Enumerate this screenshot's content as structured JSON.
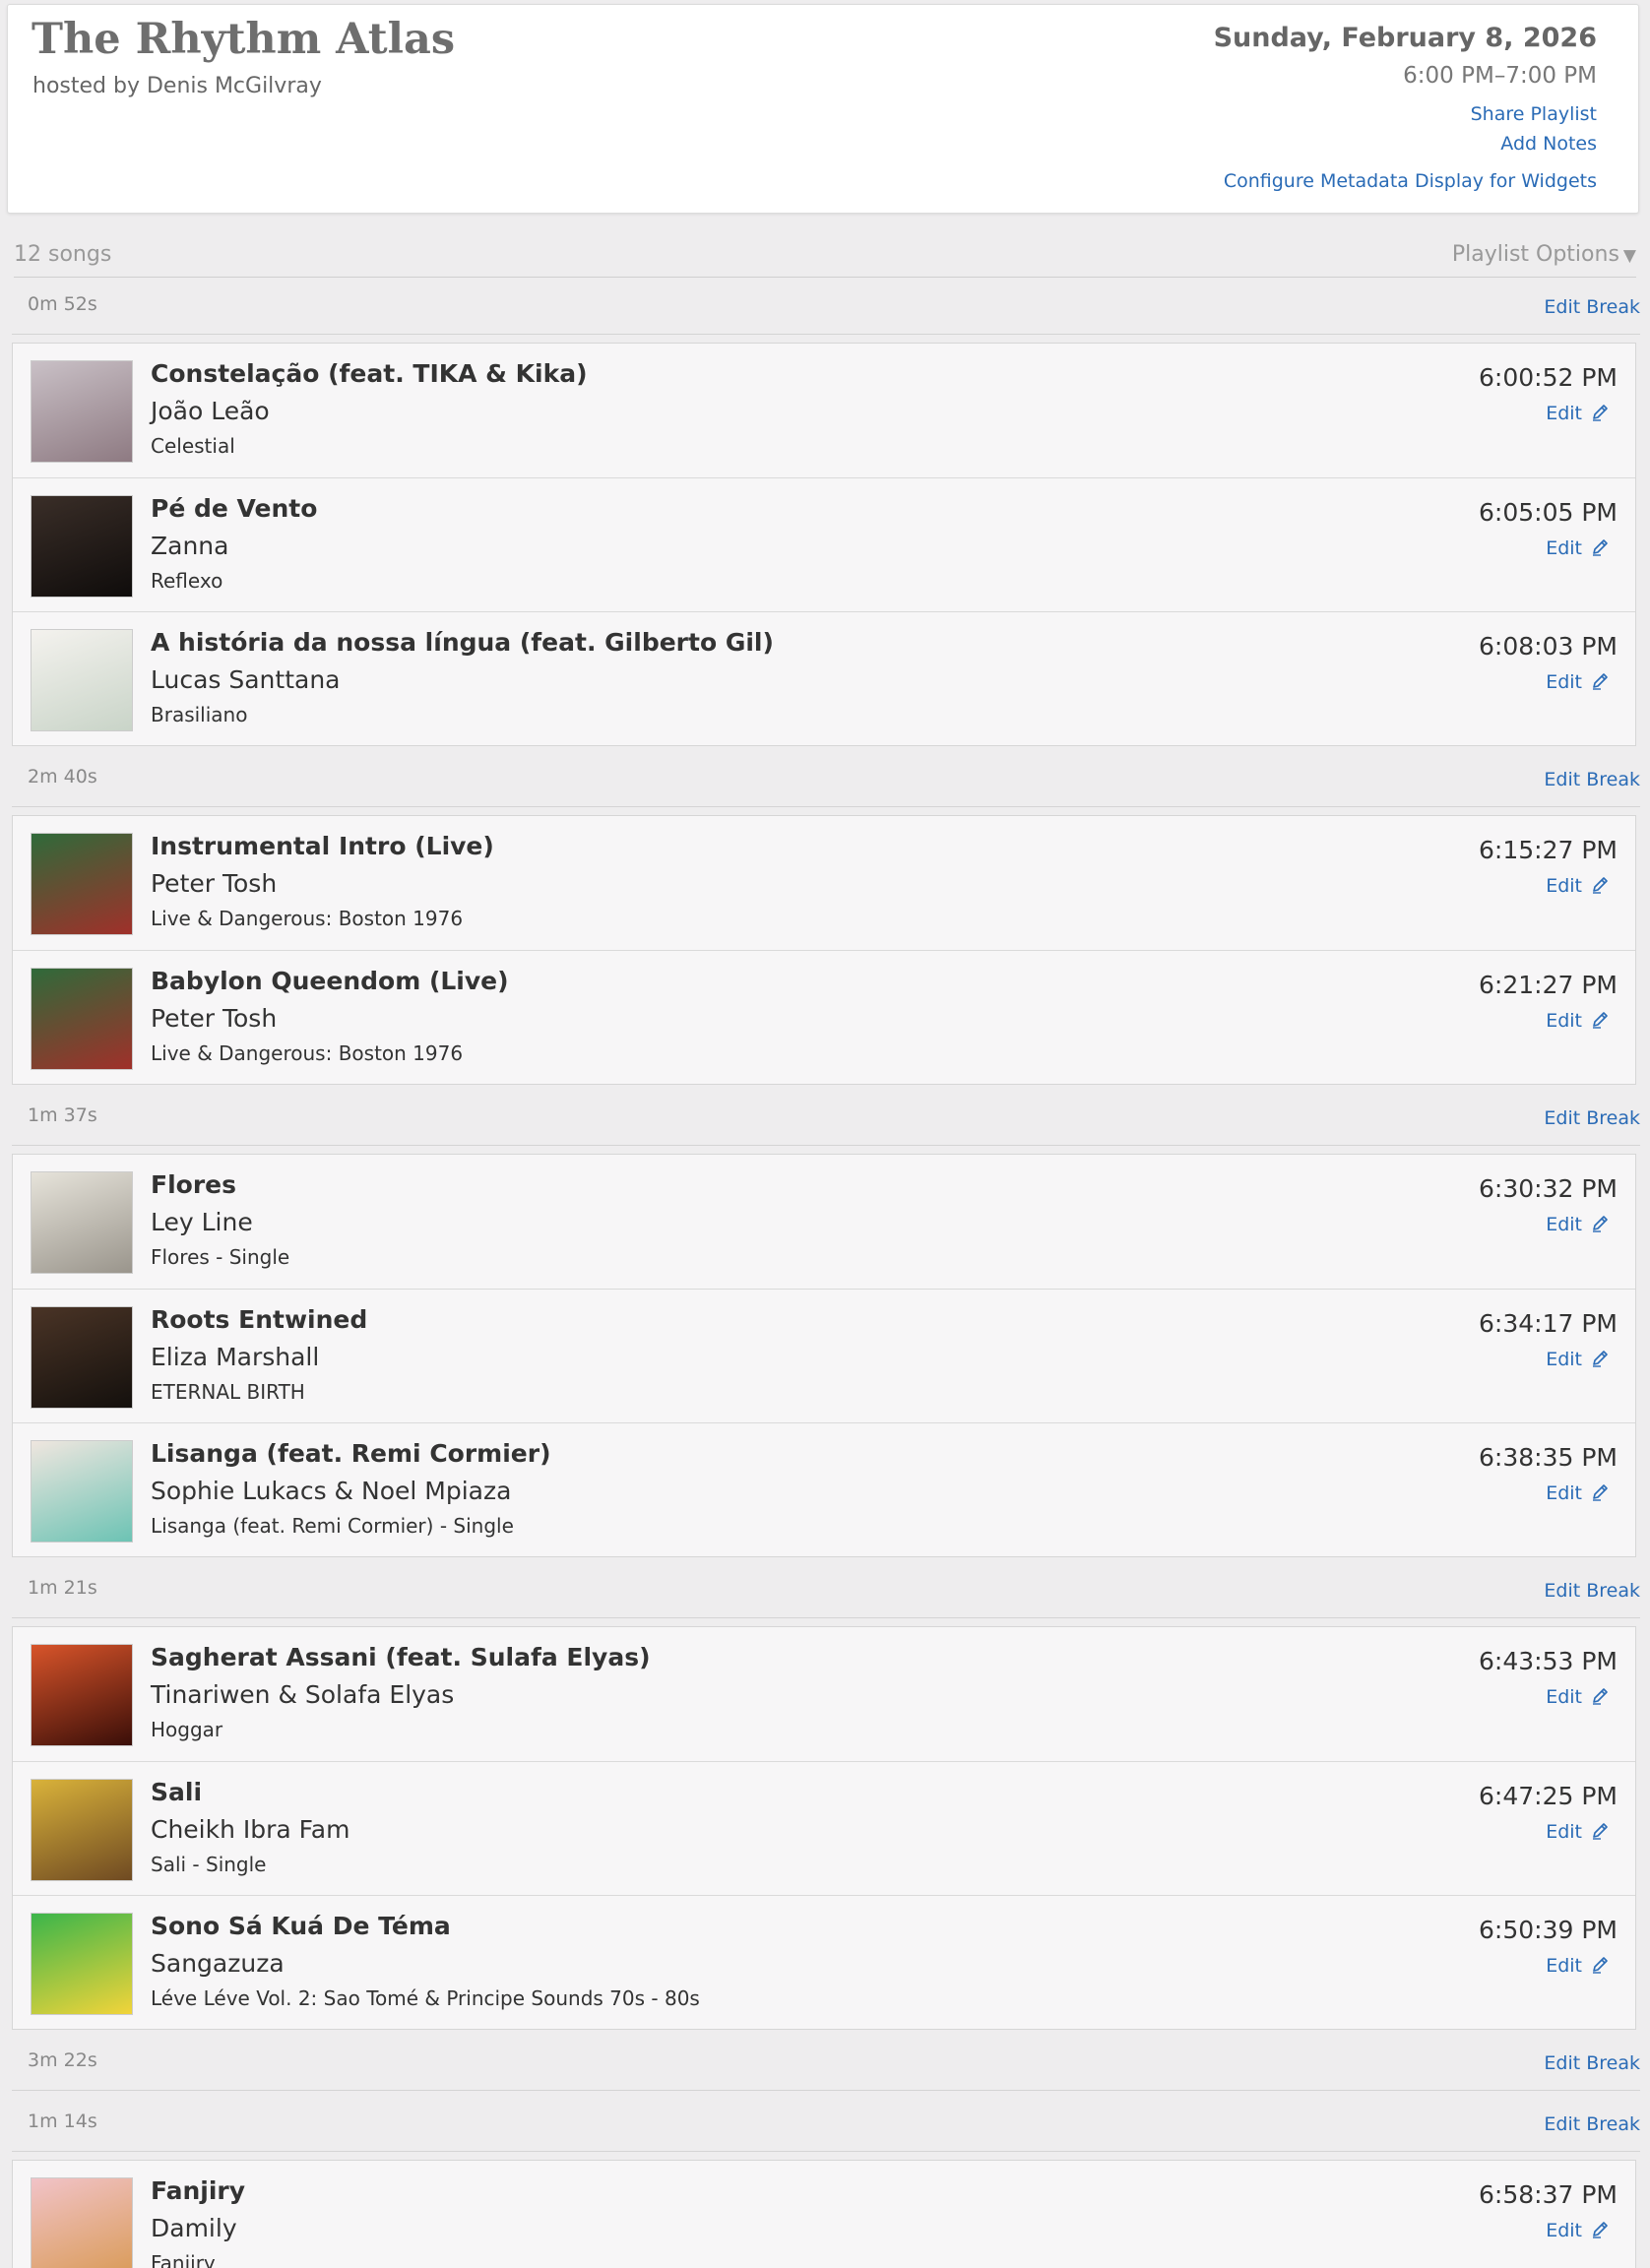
{
  "header": {
    "title": "The Rhythm Atlas",
    "host": "hosted by Denis McGilvray",
    "date": "Sunday, February 8, 2026",
    "time_range": "6:00 PM–7:00 PM",
    "share_label": "Share Playlist",
    "notes_label": "Add Notes",
    "config_label": "Configure Metadata Display for Widgets"
  },
  "summary": {
    "count": "12 songs",
    "options_label": "Playlist Options"
  },
  "edit_break_label": "Edit Break",
  "edit_label": "Edit",
  "playlist": [
    {
      "kind": "break",
      "duration": "0m 52s"
    },
    {
      "kind": "group",
      "tracks": [
        {
          "title": "Constelação (feat. TIKA & Kika)",
          "artist": "João Leão",
          "album": "Celestial",
          "time": "6:00:52 PM",
          "art": [
            "#c9c0c6",
            "#8e7a82"
          ]
        },
        {
          "title": "Pé de Vento",
          "artist": "Zanna",
          "album": "Reflexo",
          "time": "6:05:05 PM",
          "art": [
            "#3a2e28",
            "#0f0c0b"
          ]
        },
        {
          "title": "A história da nossa língua (feat. Gilberto Gil)",
          "artist": "Lucas Santtana",
          "album": "Brasiliano",
          "time": "6:08:03 PM",
          "art": [
            "#f4f2ee",
            "#c9d4c8"
          ]
        }
      ]
    },
    {
      "kind": "break",
      "duration": "2m 40s"
    },
    {
      "kind": "group",
      "tracks": [
        {
          "title": "Instrumental Intro (Live)",
          "artist": "Peter Tosh",
          "album": "Live & Dangerous: Boston 1976",
          "time": "6:15:27 PM",
          "art": [
            "#2f6a3a",
            "#a0302a"
          ]
        },
        {
          "title": "Babylon Queendom (Live)",
          "artist": "Peter Tosh",
          "album": "Live & Dangerous: Boston 1976",
          "time": "6:21:27 PM",
          "art": [
            "#2f6a3a",
            "#a0302a"
          ]
        }
      ]
    },
    {
      "kind": "break",
      "duration": "1m 37s"
    },
    {
      "kind": "group",
      "tracks": [
        {
          "title": "Flores",
          "artist": "Ley Line",
          "album": "Flores - Single",
          "time": "6:30:32 PM",
          "art": [
            "#e6e3da",
            "#9a958c"
          ]
        },
        {
          "title": "Roots Entwined",
          "artist": "Eliza Marshall",
          "album": "ETERNAL BIRTH",
          "time": "6:34:17 PM",
          "art": [
            "#4a3426",
            "#14100d"
          ]
        },
        {
          "title": "Lisanga (feat. Remi Cormier)",
          "artist": "Sophie Lukacs & Noel Mpiaza",
          "album": "Lisanga (feat. Remi Cormier) - Single",
          "time": "6:38:35 PM",
          "art": [
            "#efe6df",
            "#6cc3b4"
          ]
        }
      ]
    },
    {
      "kind": "break",
      "duration": "1m 21s"
    },
    {
      "kind": "group",
      "tracks": [
        {
          "title": "Sagherat Assani (feat. Sulafa Elyas)",
          "artist": "Tinariwen & Solafa Elyas",
          "album": "Hoggar",
          "time": "6:43:53 PM",
          "art": [
            "#d8542a",
            "#3a0e08"
          ]
        },
        {
          "title": "Sali",
          "artist": "Cheikh Ibra Fam",
          "album": "Sali - Single",
          "time": "6:47:25 PM",
          "art": [
            "#d9b23a",
            "#6f4a22"
          ]
        },
        {
          "title": "Sono Sá Kuá De Téma",
          "artist": "Sangazuza",
          "album": "Léve Léve Vol. 2: Sao Tomé & Principe Sounds 70s - 80s",
          "time": "6:50:39 PM",
          "art": [
            "#3bb54a",
            "#f2d43a"
          ]
        }
      ]
    },
    {
      "kind": "break",
      "duration": "3m 22s"
    },
    {
      "kind": "break",
      "duration": "1m 14s"
    },
    {
      "kind": "group",
      "tracks": [
        {
          "title": "Fanjiry",
          "artist": "Damily",
          "album": "Fanjiry",
          "time": "6:58:37 PM",
          "art": [
            "#f1c3c8",
            "#d99a55"
          ]
        }
      ]
    }
  ]
}
